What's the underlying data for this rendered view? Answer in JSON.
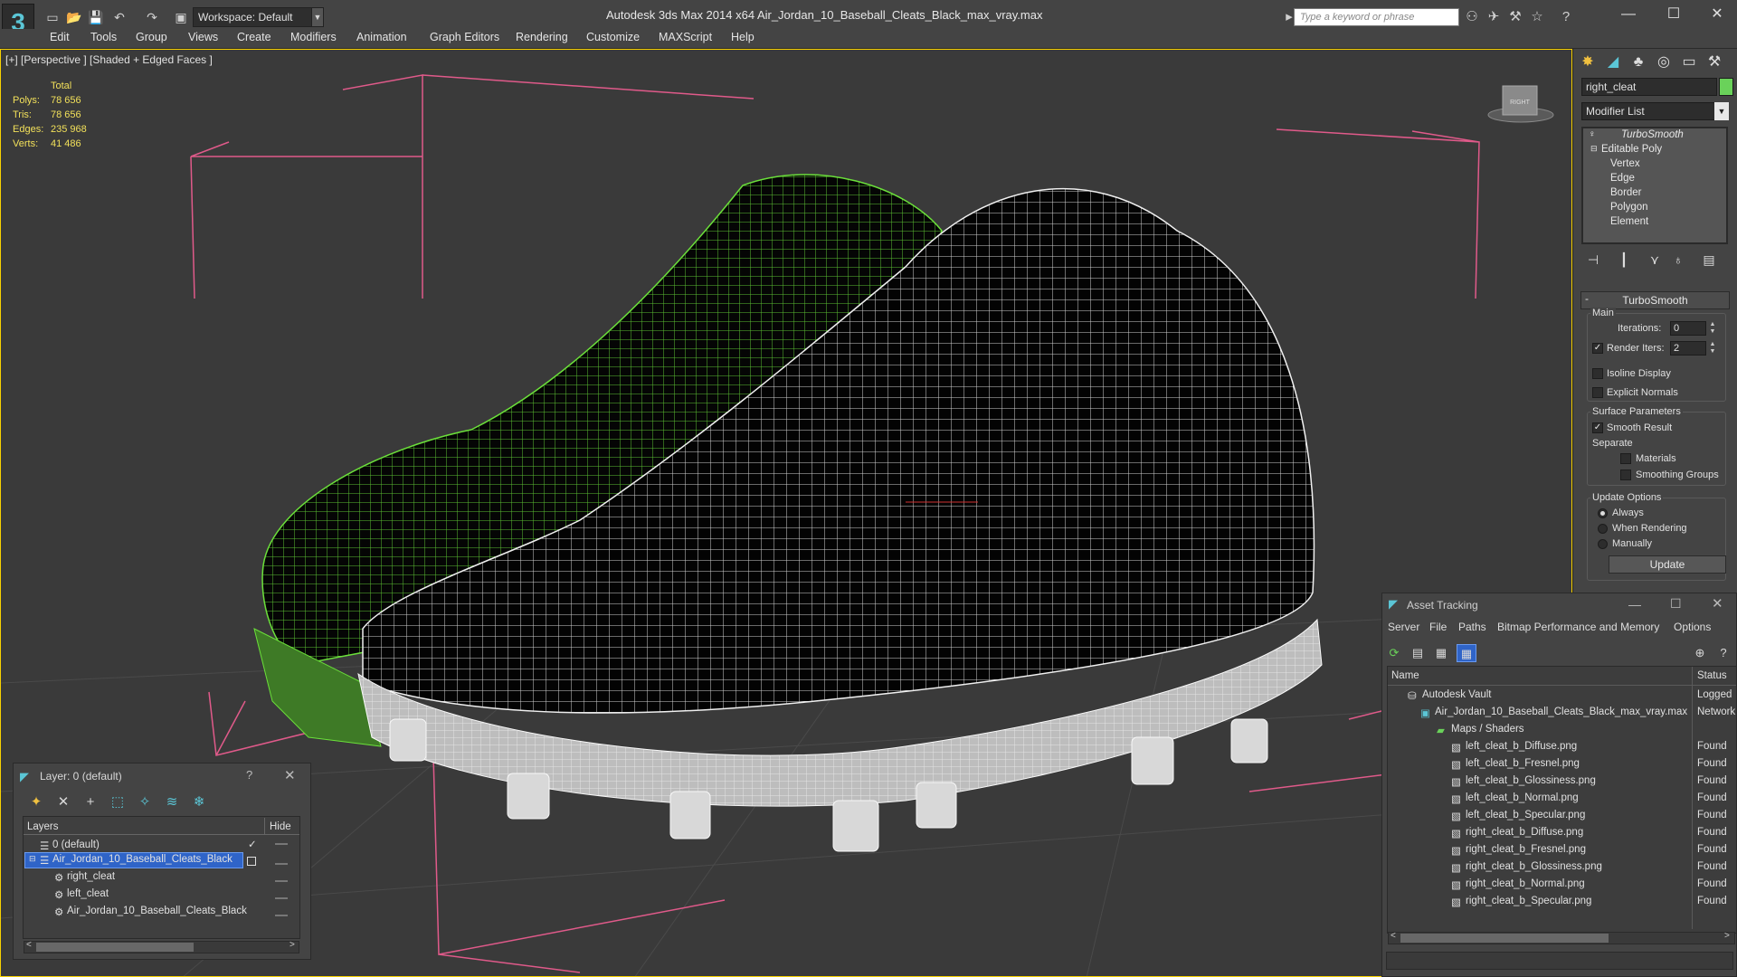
{
  "app": {
    "window_title": "Autodesk 3ds Max  2014 x64       Air_Jordan_10_Baseball_Cleats_Black_max_vray.max",
    "logo_glyph": "3",
    "workspace_label": "Workspace: Default",
    "search_placeholder": "Type a keyword or phrase"
  },
  "menu": [
    "Edit",
    "Tools",
    "Group",
    "Views",
    "Create",
    "Modifiers",
    "Animation",
    "Graph Editors",
    "Rendering",
    "Customize",
    "MAXScript",
    "Help"
  ],
  "viewport": {
    "label": "[+] [Perspective ] [Shaded + Edged Faces ]",
    "stats": {
      "header": "Total",
      "rows": [
        {
          "label": "Polys:",
          "value": "78 656"
        },
        {
          "label": "Tris:",
          "value": "78 656"
        },
        {
          "label": "Edges:",
          "value": "235 968"
        },
        {
          "label": "Verts:",
          "value": "41 486"
        }
      ]
    },
    "viewcube_label": "RIGHT"
  },
  "command_panel": {
    "object_name": "right_cleat",
    "modifier_list": "Modifier List",
    "stack": [
      "TurboSmooth",
      "Editable Poly",
      "Vertex",
      "Edge",
      "Border",
      "Polygon",
      "Element"
    ],
    "rollout_title": "TurboSmooth",
    "main_group": "Main",
    "iterations_label": "Iterations:",
    "iterations_value": "0",
    "render_iters_label": "Render Iters:",
    "render_iters_value": "2",
    "isoline_label": "Isoline Display",
    "explicit_normals_label": "Explicit Normals",
    "surface_group": "Surface Parameters",
    "smooth_result_label": "Smooth Result",
    "separate_label": "Separate",
    "materials_label": "Materials",
    "smoothing_groups_label": "Smoothing Groups",
    "update_group": "Update Options",
    "always_label": "Always",
    "when_rendering_label": "When Rendering",
    "manually_label": "Manually",
    "update_button": "Update"
  },
  "layer_window": {
    "title": "Layer: 0 (default)",
    "help": "?",
    "col_layers": "Layers",
    "col_hide": "Hide",
    "rows": [
      "0 (default)",
      "Air_Jordan_10_Baseball_Cleats_Black",
      "right_cleat",
      "left_cleat",
      "Air_Jordan_10_Baseball_Cleats_Black"
    ]
  },
  "asset_window": {
    "title": "Asset Tracking",
    "menu": [
      "Server",
      "File",
      "Paths",
      "Bitmap Performance and Memory",
      "Options"
    ],
    "col_name": "Name",
    "col_status": "Status",
    "rows": [
      {
        "name": "Autodesk Vault",
        "status": "Logged"
      },
      {
        "name": "Air_Jordan_10_Baseball_Cleats_Black_max_vray.max",
        "status": "Network"
      },
      {
        "name": "Maps / Shaders",
        "status": ""
      },
      {
        "name": "left_cleat_b_Diffuse.png",
        "status": "Found"
      },
      {
        "name": "left_cleat_b_Fresnel.png",
        "status": "Found"
      },
      {
        "name": "left_cleat_b_Glossiness.png",
        "status": "Found"
      },
      {
        "name": "left_cleat_b_Normal.png",
        "status": "Found"
      },
      {
        "name": "left_cleat_b_Specular.png",
        "status": "Found"
      },
      {
        "name": "right_cleat_b_Diffuse.png",
        "status": "Found"
      },
      {
        "name": "right_cleat_b_Fresnel.png",
        "status": "Found"
      },
      {
        "name": "right_cleat_b_Glossiness.png",
        "status": "Found"
      },
      {
        "name": "right_cleat_b_Normal.png",
        "status": "Found"
      },
      {
        "name": "right_cleat_b_Specular.png",
        "status": "Found"
      }
    ]
  },
  "colors": {
    "accent": "#5bc6d6",
    "selection": "#2f64c8",
    "viewport_border": "#f7d100",
    "wire_green": "#6be03a",
    "stats_yellow": "#f2e05a"
  }
}
